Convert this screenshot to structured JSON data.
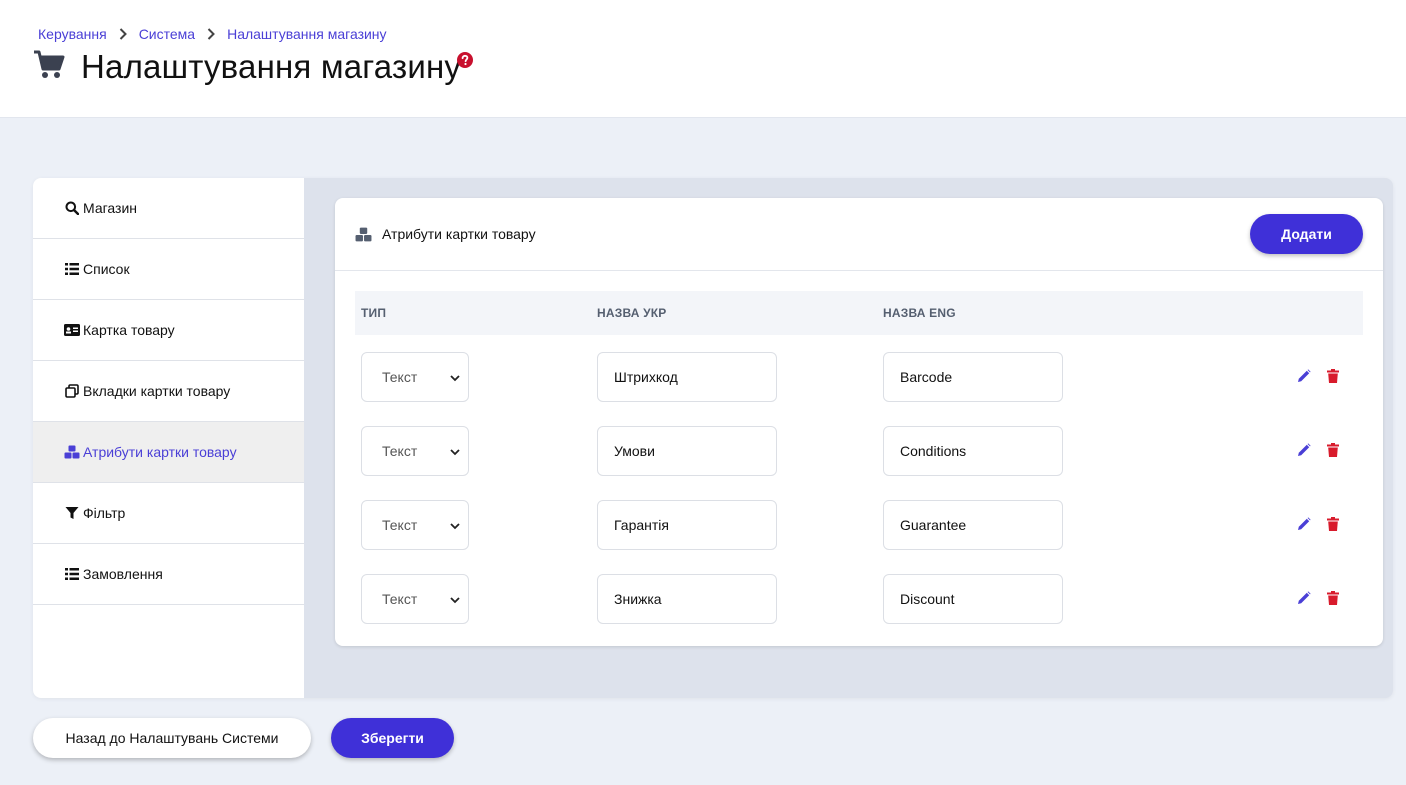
{
  "breadcrumb": [
    {
      "label": "Керування"
    },
    {
      "label": "Система"
    },
    {
      "label": "Налаштування магазину"
    }
  ],
  "page": {
    "title": "Налаштування магазину",
    "title_icon": "shopping-cart-icon",
    "help_icon": "help-circle-icon"
  },
  "sidebar": {
    "items": [
      {
        "label": "Магазин",
        "icon": "search-icon",
        "active": false
      },
      {
        "label": "Список",
        "icon": "list-icon",
        "active": false
      },
      {
        "label": "Картка товару",
        "icon": "id-card-icon",
        "active": false
      },
      {
        "label": "Вкладки картки товару",
        "icon": "copy-icon",
        "active": false
      },
      {
        "label": "Атрибути картки товару",
        "icon": "cubes-icon",
        "active": true
      },
      {
        "label": "Фільтр",
        "icon": "filter-icon",
        "active": false
      },
      {
        "label": "Замовлення",
        "icon": "list-icon",
        "active": false
      }
    ]
  },
  "card": {
    "title": "Атрибути картки товару",
    "icon": "cubes-icon",
    "add_label": "Додати"
  },
  "table": {
    "columns": [
      "ТИП",
      "НАЗВА УКР",
      "НАЗВА ENG"
    ],
    "rows": [
      {
        "type": "Текст",
        "name_ukr": "Штрихкод",
        "name_eng": "Barcode"
      },
      {
        "type": "Текст",
        "name_ukr": "Умови",
        "name_eng": "Conditions"
      },
      {
        "type": "Текст",
        "name_ukr": "Гарантія",
        "name_eng": "Guarantee"
      },
      {
        "type": "Текст",
        "name_ukr": "Знижка",
        "name_eng": "Discount"
      }
    ]
  },
  "footer": {
    "back_label": "Назад до Налаштувань Системи",
    "save_label": "Зберегти"
  },
  "colors": {
    "accent": "#3f30d8",
    "link": "#4a3fd6",
    "delete": "#d81b2c",
    "help": "#c8102e"
  }
}
